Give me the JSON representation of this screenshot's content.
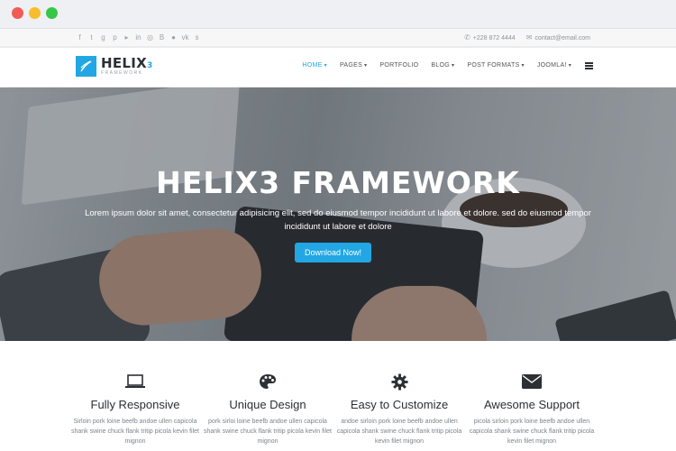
{
  "topbar": {
    "social_icons": [
      "facebook-icon",
      "twitter-icon",
      "google-plus-icon",
      "pinterest-icon",
      "youtube-icon",
      "linkedin-icon",
      "dribbble-icon",
      "behance-icon",
      "flickr-icon",
      "vk-icon",
      "skype-icon"
    ],
    "phone": "+228 872 4444",
    "email": "contact@email.com"
  },
  "header": {
    "logo_name": "HELIX",
    "logo_sub": "3",
    "logo_tagline": "FRAMEWORK",
    "nav": [
      {
        "label": "HOME",
        "active": true,
        "dropdown": true
      },
      {
        "label": "PAGES",
        "active": false,
        "dropdown": true
      },
      {
        "label": "PORTFOLIO",
        "active": false,
        "dropdown": false
      },
      {
        "label": "BLOG",
        "active": false,
        "dropdown": true
      },
      {
        "label": "POST FORMATS",
        "active": false,
        "dropdown": true
      },
      {
        "label": "JOOMLA!",
        "active": false,
        "dropdown": true
      }
    ]
  },
  "hero": {
    "title": "HELIX3 FRAMEWORK",
    "text": "Lorem ipsum dolor sit amet, consectetur adipisicing elit, sed do eiusmod tempor incididunt ut labore et dolore. sed do eiusmod tempor incididunt ut labore et dolore",
    "button": "Download Now!"
  },
  "features": [
    {
      "icon": "laptop-icon",
      "title": "Fully Responsive",
      "text": "Sirloin pork loine beefb andoe ullen capicola shank swine chuck flank tritip picola kevin filet mignon"
    },
    {
      "icon": "palette-icon",
      "title": "Unique Design",
      "text": "pork sirloi loine beefb andoe ullen capicola shank swine chuck flank tritip picola kevin filet mignon"
    },
    {
      "icon": "gear-icon",
      "title": "Easy to Customize",
      "text": "andoe sirloin pork loine beefb andoe ullen capicola shank swine chuck flank tritip picola kevin filet mignon"
    },
    {
      "icon": "envelope-icon",
      "title": "Awesome Support",
      "text": "picola sirloin pork loine beefb andoe ullen capicola shank swine chuck flank tritip picola kevin filet mignon"
    }
  ],
  "colors": {
    "accent": "#22a7e4",
    "dark": "#2c2f33"
  }
}
